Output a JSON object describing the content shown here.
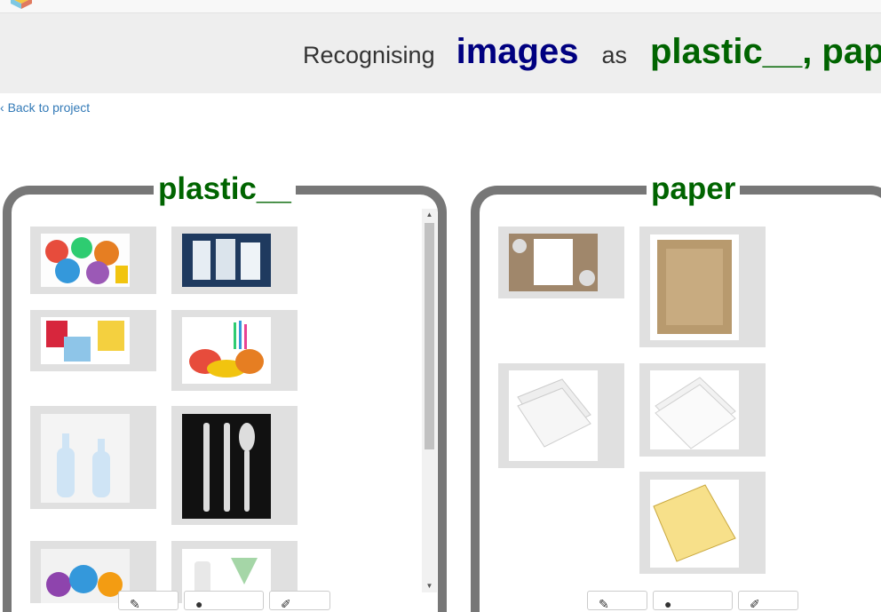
{
  "header": {
    "word1": "Recognising",
    "word2": "images",
    "word3": "as",
    "word4": "plastic__, pap"
  },
  "nav": {
    "back_link": "Back to project"
  },
  "buckets": [
    {
      "title": "plastic__"
    },
    {
      "title": "paper"
    }
  ],
  "colors": {
    "images_word": "#000080",
    "label_word": "#006400",
    "bucket_border": "#777777",
    "tile_bg": "#e0e0e0"
  },
  "icons": [
    "logo-icon",
    "scroll-up-icon",
    "scroll-down-icon",
    "pencil-icon",
    "camera-icon",
    "draw-icon"
  ]
}
